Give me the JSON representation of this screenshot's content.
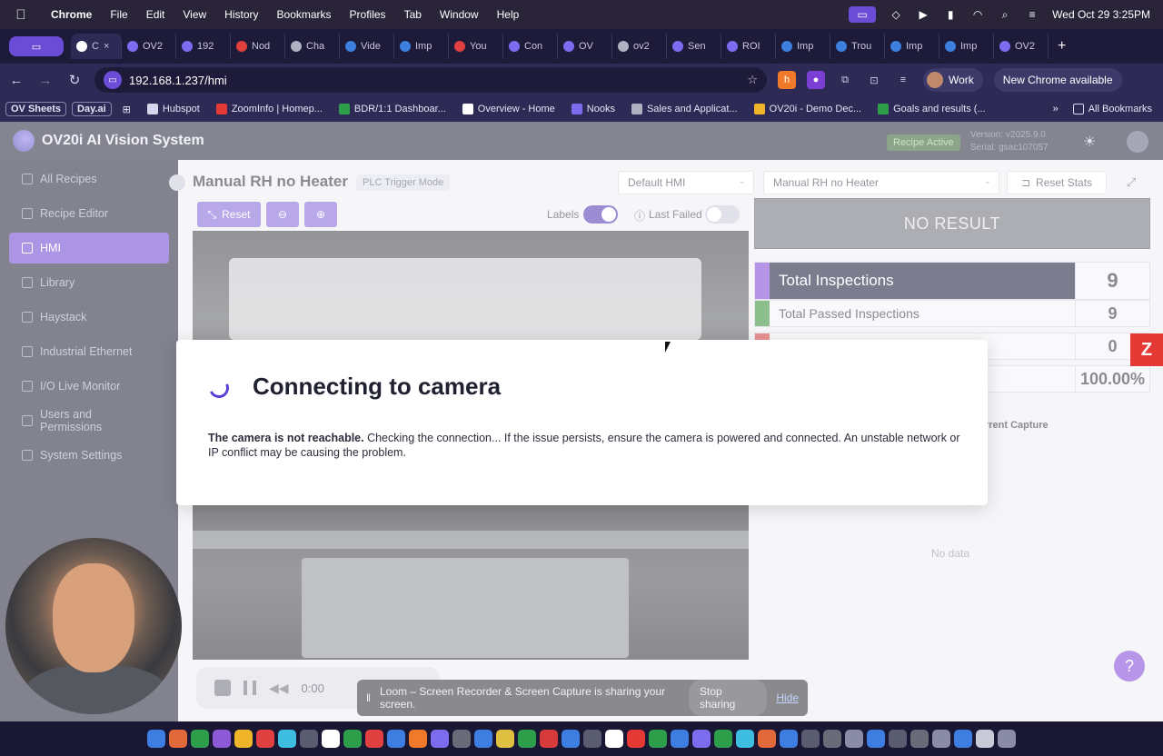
{
  "menubar": {
    "app": "Chrome",
    "items": [
      "File",
      "Edit",
      "View",
      "History",
      "Bookmarks",
      "Profiles",
      "Tab",
      "Window",
      "Help"
    ],
    "datetime": "Wed Oct 29  3:25PM"
  },
  "tabs": [
    {
      "label": "C",
      "color": "#ffffff"
    },
    {
      "label": "OV2",
      "color": "#7b6cf0"
    },
    {
      "label": "192",
      "color": "#7b6cf0"
    },
    {
      "label": "Nod",
      "color": "#e0403a"
    },
    {
      "label": "Cha",
      "color": "#b0b0c0"
    },
    {
      "label": "Vide",
      "color": "#3d7ee0"
    },
    {
      "label": "Imp",
      "color": "#3d7ee0"
    },
    {
      "label": "You",
      "color": "#e04040"
    },
    {
      "label": "Con",
      "color": "#7b6cf0"
    },
    {
      "label": "OV",
      "color": "#7b6cf0"
    },
    {
      "label": "ov2",
      "color": "#b0b0c0"
    },
    {
      "label": "Sen",
      "color": "#7b6cf0"
    },
    {
      "label": "ROI",
      "color": "#7b6cf0"
    },
    {
      "label": "Imp",
      "color": "#3d7ee0"
    },
    {
      "label": "Trou",
      "color": "#3d7ee0"
    },
    {
      "label": "Imp",
      "color": "#3d7ee0"
    },
    {
      "label": "Imp",
      "color": "#3d7ee0"
    },
    {
      "label": "OV2",
      "color": "#7b6cf0"
    }
  ],
  "address": {
    "url": "192.168.1.237/hmi",
    "profile": "Work",
    "new_chrome": "New Chrome available"
  },
  "bookmarks": {
    "pills": [
      "OV Sheets",
      "Day.ai"
    ],
    "items": [
      {
        "label": "Hubspot",
        "color": "#d7d4ee"
      },
      {
        "label": "ZoomInfo | Homep...",
        "color": "#e53935"
      },
      {
        "label": "BDR/1:1 Dashboar...",
        "color": "#2e9e4a"
      },
      {
        "label": "Overview - Home",
        "color": "#ffffff"
      },
      {
        "label": "Nooks",
        "color": "#7b6cf0"
      },
      {
        "label": "Sales and Applicat...",
        "color": "#b0b0c0"
      },
      {
        "label": "OV20i - Demo Dec...",
        "color": "#f0b429"
      },
      {
        "label": "Goals and results (...",
        "color": "#2e9e4a"
      }
    ],
    "more": "»",
    "all": "All Bookmarks"
  },
  "app": {
    "title": "OV20i AI Vision System",
    "recipe_badge": "Recipe Active",
    "version": "Version: v2025.9.0",
    "serial": "Serial: gsac107057"
  },
  "sidebar": {
    "items": [
      {
        "label": "All Recipes",
        "active": false
      },
      {
        "label": "Recipe Editor",
        "active": false
      },
      {
        "label": "HMI",
        "active": true
      },
      {
        "label": "Library",
        "active": false
      },
      {
        "label": "Haystack",
        "active": false
      },
      {
        "label": "Industrial Ethernet",
        "active": false
      },
      {
        "label": "I/O Live Monitor",
        "active": false
      },
      {
        "label": "Users and Permissions",
        "active": false
      },
      {
        "label": "System Settings",
        "active": false
      }
    ]
  },
  "main": {
    "title": "Manual RH no Heater",
    "mode": "PLC Trigger Mode",
    "hmi_select": "Default HMI",
    "recipe_select": "Manual RH no Heater",
    "reset_stats": "Reset Stats",
    "reset": "Reset",
    "labels_toggle": "Labels",
    "labels_on": true,
    "last_failed_toggle": "Last Failed",
    "last_failed_on": false
  },
  "results": {
    "no_result": "NO RESULT",
    "stats": [
      {
        "label": "Total Inspections",
        "value": "9",
        "bar": "#7a3fd6"
      },
      {
        "label": "Total Passed Inspections",
        "value": "9",
        "bar": "#2e8b2e"
      },
      {
        "label": "",
        "value": "0",
        "bar": "#d63a3a"
      },
      {
        "label": "",
        "value": "100.00%",
        "bar": "#c9cad8"
      }
    ],
    "capture_label": "rrent Capture",
    "no_data": "No data"
  },
  "modal": {
    "title": "Connecting to camera",
    "message_bold": "The camera is not reachable.",
    "message": " Checking the connection... If the issue persists, ensure the camera is powered and connected. An unstable network or IP conflict may be causing the problem."
  },
  "player": {
    "time": "0:00"
  },
  "loom": {
    "message": "Loom – Screen Recorder & Screen Capture is sharing your screen.",
    "stop": "Stop sharing",
    "hide": "Hide"
  },
  "colors": {
    "accent": "#6a3fd1",
    "badge_green": "#2e5b2a"
  }
}
